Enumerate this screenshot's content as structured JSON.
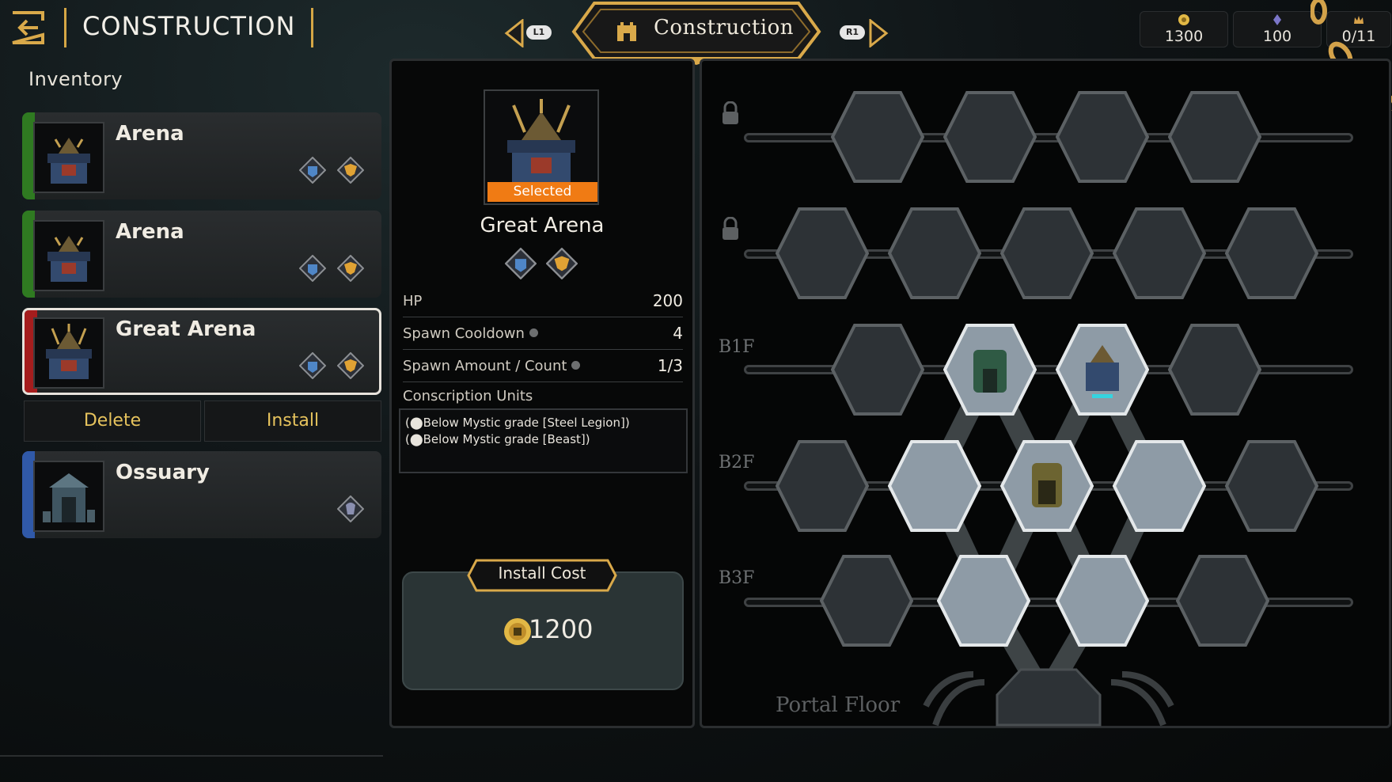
{
  "header": {
    "back_icon": "exit-arrow-icon",
    "title": "CONSTRUCTION",
    "inventory_label": "Inventory"
  },
  "tab": {
    "label": "Construction",
    "icon": "castle-icon",
    "prev_hint": "L1",
    "next_hint": "R1"
  },
  "resources": [
    {
      "icon": "gold-coin-icon",
      "value": "1300",
      "color": "#e2b845"
    },
    {
      "icon": "crystal-icon",
      "value": "100",
      "color": "#7b76c9"
    },
    {
      "icon": "crown-icon",
      "value": "0/11",
      "color": "#d8a24a"
    }
  ],
  "inventory": [
    {
      "name": "Arena",
      "stripe": "#2f7a21",
      "tags": [
        "steel-legion-icon",
        "beast-icon"
      ]
    },
    {
      "name": "Arena",
      "stripe": "#2f7a21",
      "tags": [
        "steel-legion-icon",
        "beast-icon"
      ]
    },
    {
      "name": "Great Arena",
      "stripe": "#a51d1d",
      "tags": [
        "steel-legion-icon",
        "beast-icon"
      ],
      "selected": true
    },
    {
      "name": "Ossuary",
      "stripe": "#3059a8",
      "tags": [
        "undead-icon"
      ]
    }
  ],
  "actions": {
    "delete": "Delete",
    "install": "Install"
  },
  "detail": {
    "badge": "Selected",
    "name": "Great Arena",
    "stats": [
      {
        "label": "HP",
        "value": "200",
        "info": false
      },
      {
        "label": "Spawn Cooldown",
        "value": "4",
        "info": true
      },
      {
        "label": "Spawn Amount / Count",
        "value": "1/3",
        "info": true
      }
    ],
    "conscription_label": "Conscription Units",
    "conscription_lines": [
      "(⬤Below Mystic grade [Steel Legion])",
      "(⬤Below Mystic grade [Beast])"
    ],
    "install_cost_label": "Install Cost",
    "install_cost": "1200"
  },
  "grid": {
    "floors": [
      "B1F",
      "B2F",
      "B3F"
    ],
    "portal_label": "Portal Floor",
    "rows": [
      {
        "locked": true,
        "cells": [
          "empty",
          "empty",
          "empty",
          "empty"
        ]
      },
      {
        "locked": true,
        "cells": [
          "empty",
          "empty",
          "empty",
          "empty",
          "empty"
        ]
      },
      {
        "floor": "B1F",
        "cells": [
          "empty",
          "ossuary-room",
          "arena-room",
          "empty"
        ]
      },
      {
        "floor": "B2F",
        "cells": [
          "empty",
          "open",
          "shrine-room",
          "open",
          "empty"
        ]
      },
      {
        "floor": "B3F",
        "cells": [
          "empty",
          "open",
          "open",
          "empty"
        ]
      }
    ]
  }
}
